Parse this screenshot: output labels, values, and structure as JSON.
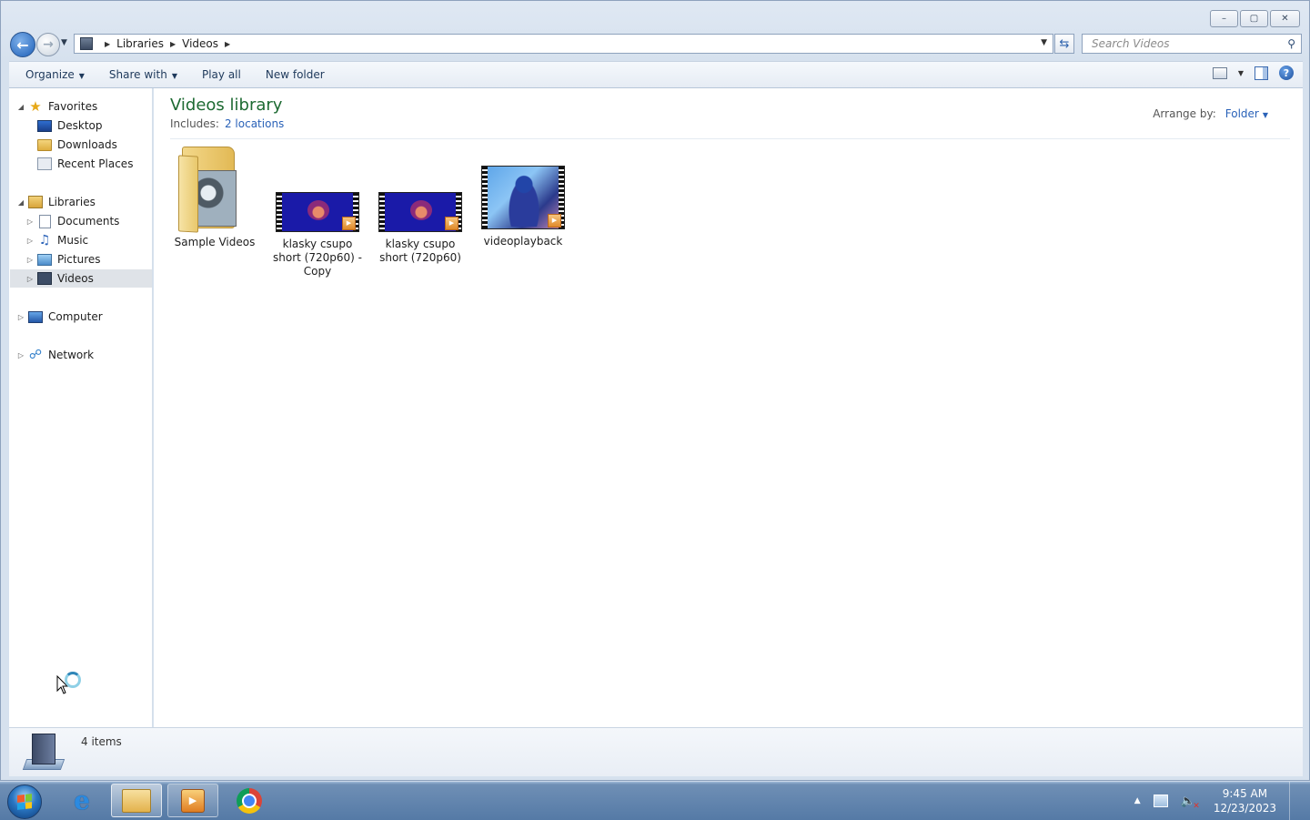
{
  "window": {
    "caption_buttons": {
      "minimize": "–",
      "maximize": "▢",
      "close": "✕"
    }
  },
  "address": {
    "crumbs": [
      "Libraries",
      "Videos"
    ],
    "search_placeholder": "Search Videos"
  },
  "toolbar": {
    "organize": "Organize",
    "share_with": "Share with",
    "play_all": "Play all",
    "new_folder": "New folder"
  },
  "nav": {
    "favorites": "Favorites",
    "desktop": "Desktop",
    "downloads": "Downloads",
    "recent_places": "Recent Places",
    "libraries": "Libraries",
    "documents": "Documents",
    "music": "Music",
    "pictures": "Pictures",
    "videos": "Videos",
    "computer": "Computer",
    "network": "Network"
  },
  "library": {
    "title": "Videos library",
    "includes_label": "Includes:",
    "includes_link": "2 locations",
    "arrange_label": "Arrange by:",
    "arrange_value": "Folder"
  },
  "files": [
    {
      "name": "Sample Videos",
      "kind": "folder"
    },
    {
      "name": "klasky csupo short (720p60) - Copy",
      "kind": "video"
    },
    {
      "name": "klasky csupo short (720p60)",
      "kind": "video"
    },
    {
      "name": "videoplayback",
      "kind": "video"
    }
  ],
  "status": {
    "item_count": "4 items"
  },
  "taskbar": {
    "time": "9:45 AM",
    "date": "12/23/2023",
    "icons": [
      "start-orb",
      "internet-explorer-icon",
      "windows-explorer-icon",
      "media-player-icon",
      "chrome-icon"
    ]
  }
}
